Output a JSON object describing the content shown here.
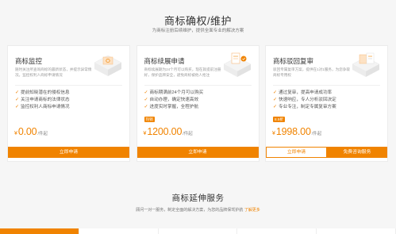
{
  "section": {
    "title": "商标确权/维护",
    "subtitle": "为商标注册后续维护，提供全面专业的解决方案"
  },
  "cards": [
    {
      "title": "商标监控",
      "desc": "随时关注所查询商标的最新状态，并提示异常情况，监控权利人商标申请情况",
      "features": [
        "提前知晓潜在的侵权信息",
        "关注申请商标的法律状态",
        "监控权利人商标申请情况"
      ],
      "badge": "",
      "currency": "¥",
      "amount": "0.00",
      "unit": "/件起",
      "buttons": [
        "立即申请"
      ]
    },
    {
      "title": "商标续展申请",
      "desc": "商标续展期为24个月可以购买，现在就提前注册好，保护品牌安全，避免商标被他人抢注",
      "features": [
        "商标期满前24个月可以购买",
        "自动办理，确定快速高效",
        "进度实时掌握，全程护航"
      ],
      "badge": "热销",
      "currency": "¥",
      "amount": "1200.00",
      "unit": "/件起",
      "buttons": [
        "立即申请"
      ]
    },
    {
      "title": "商标驳回复审",
      "desc": "驳回专属复审方案，提供在1对1服务，为您争取商标专用权",
      "features": [
        "通过复审，提高申请成功率",
        "快速响应，专人分析驳回决定",
        "专业专注，制定专属复审方案"
      ],
      "badge": "8.5折",
      "currency": "¥",
      "amount": "1998.00",
      "unit": "/件起",
      "buttons": [
        "立即申请",
        "免费咨询服务"
      ]
    }
  ],
  "extension": {
    "title": "商标延伸服务",
    "subtitle": "顾问一对一服务，制定全面的解决方案，为您的品牌保驾护航",
    "link": "了解更多"
  },
  "colors": {
    "accent": "#f08300",
    "background": "#f6f6f6"
  }
}
